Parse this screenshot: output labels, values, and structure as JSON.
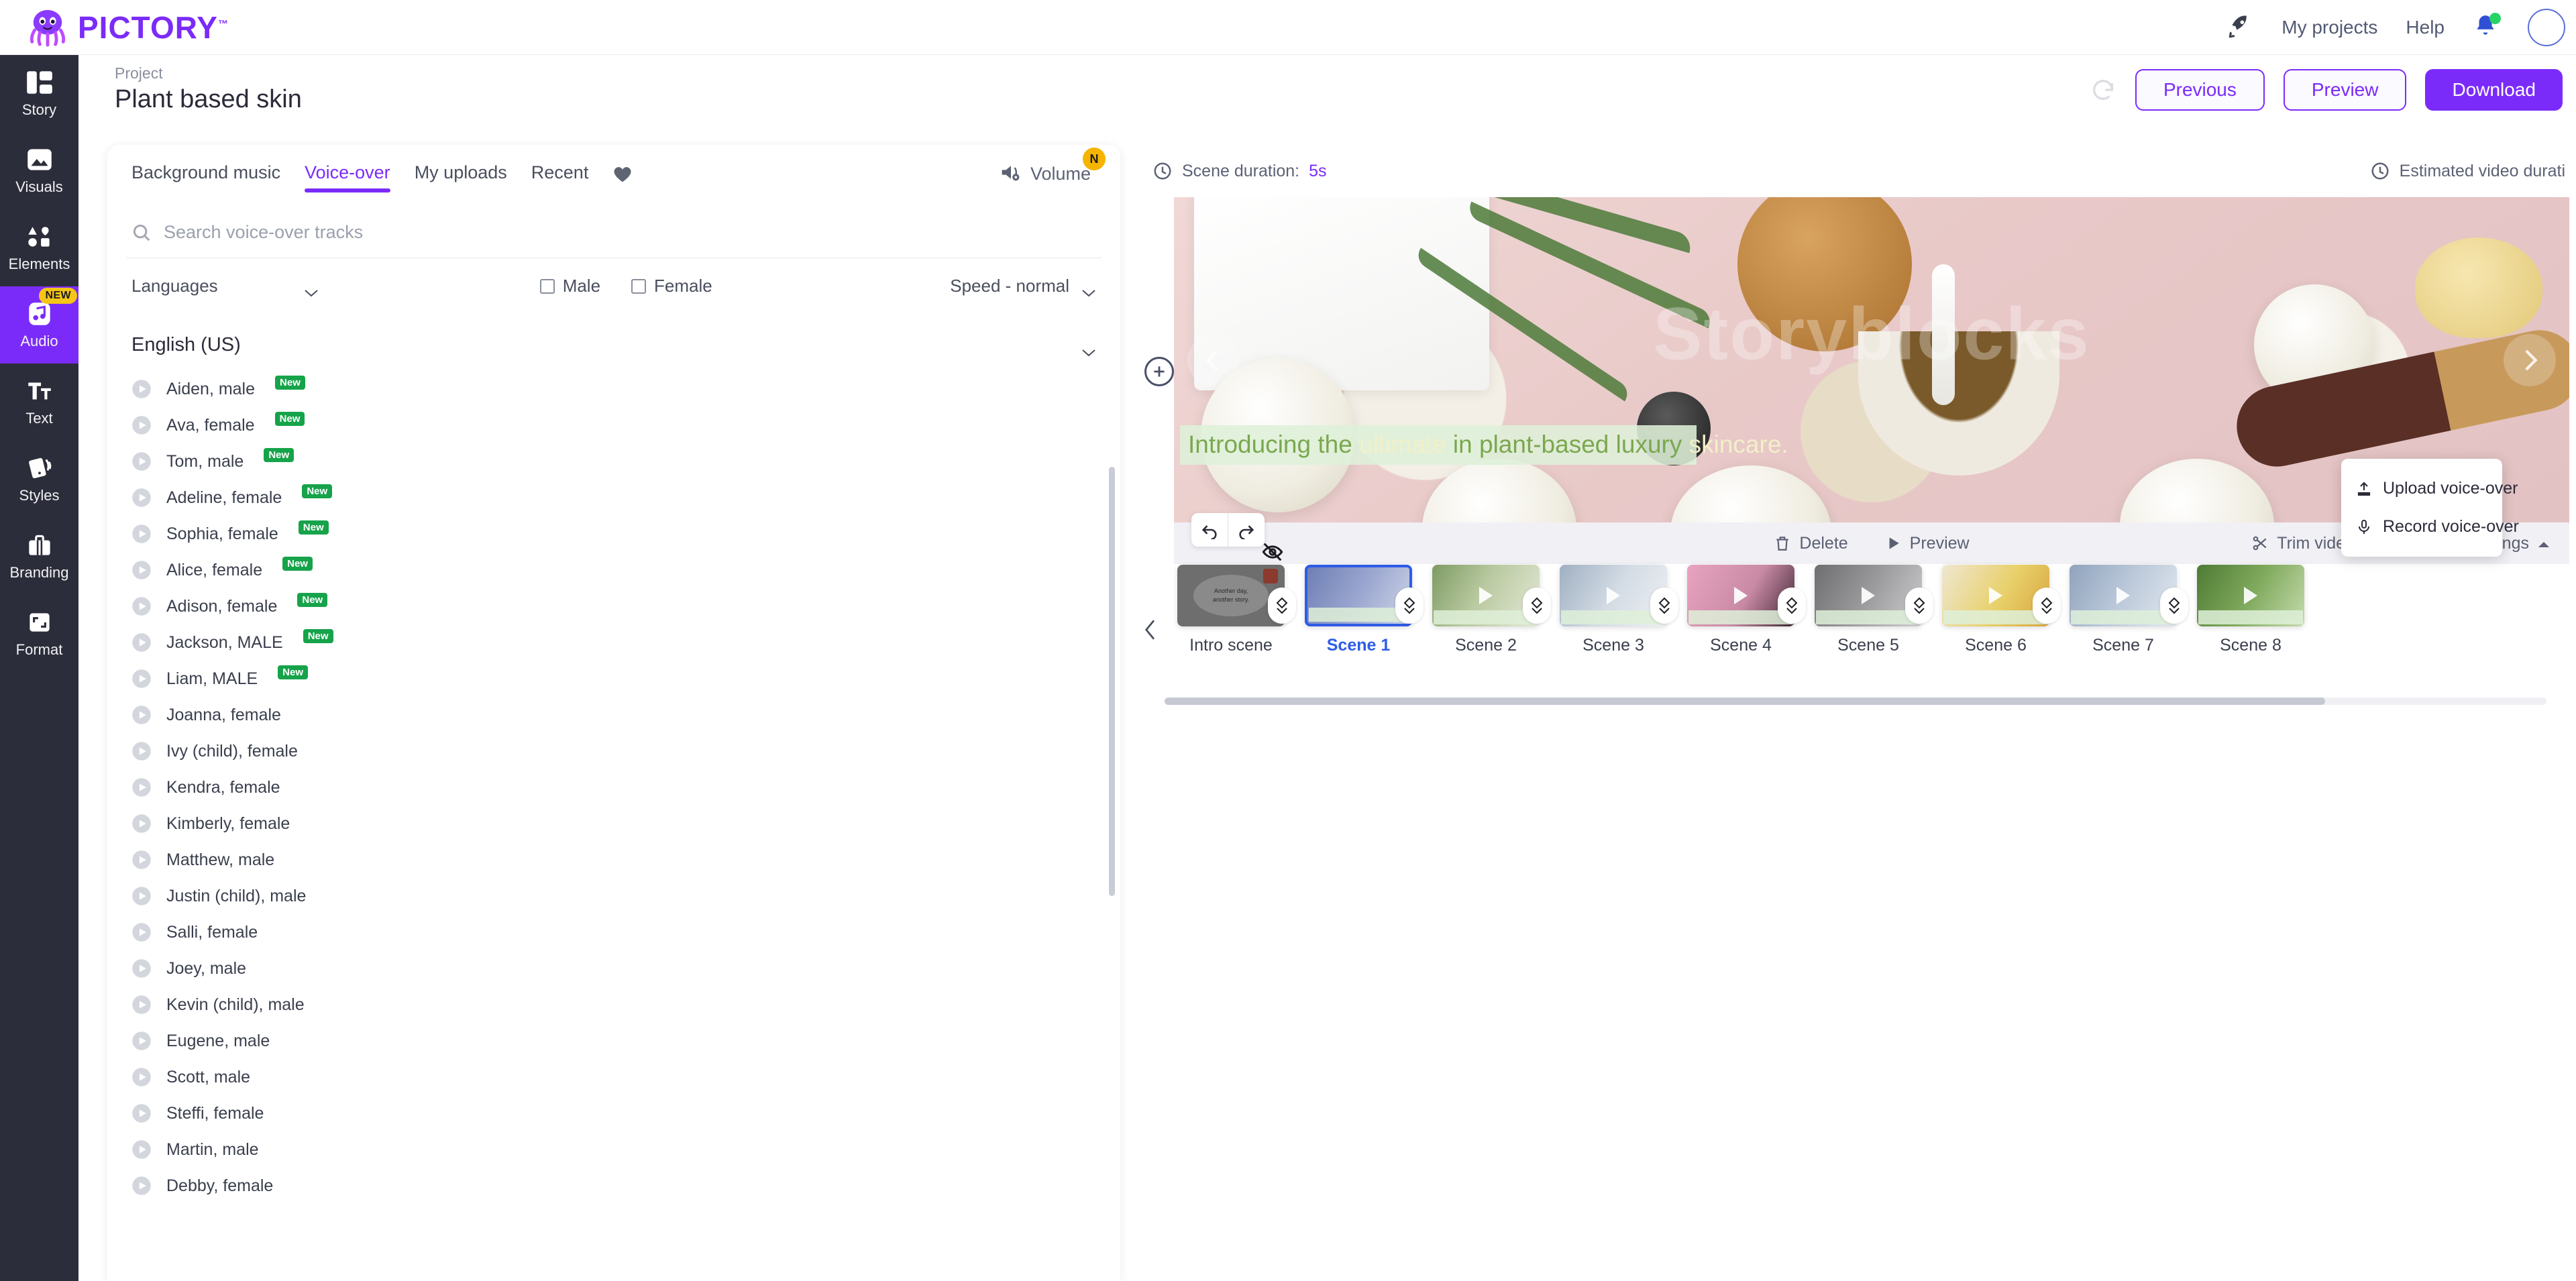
{
  "topbar": {
    "brand": "PICTORY",
    "brand_tm": "™",
    "brand_color": "#7B2BF9",
    "rocket_icon": "rocket-icon",
    "my_projects": "My projects",
    "help": "Help",
    "bell_icon": "notification-bell-icon",
    "avatar": "user-avatar"
  },
  "rail": {
    "items": [
      {
        "label": "Story",
        "icon": "story-icon",
        "active": false,
        "badge": ""
      },
      {
        "label": "Visuals",
        "icon": "image-icon",
        "active": false,
        "badge": ""
      },
      {
        "label": "Elements",
        "icon": "shapes-icon",
        "active": false,
        "badge": ""
      },
      {
        "label": "Audio",
        "icon": "music-note-icon",
        "active": true,
        "badge": "NEW"
      },
      {
        "label": "Text",
        "icon": "text-icon",
        "active": false,
        "badge": ""
      },
      {
        "label": "Styles",
        "icon": "cards-icon",
        "active": false,
        "badge": ""
      },
      {
        "label": "Branding",
        "icon": "briefcase-icon",
        "active": false,
        "badge": ""
      },
      {
        "label": "Format",
        "icon": "crop-icon",
        "active": false,
        "badge": ""
      }
    ]
  },
  "project": {
    "kicker": "Project",
    "title": "Plant based skin",
    "refresh_icon": "refresh-icon",
    "previous": "Previous",
    "preview": "Preview",
    "download": "Download"
  },
  "panel": {
    "tabs": [
      {
        "label": "Background music",
        "active": false
      },
      {
        "label": "Voice-over",
        "active": true
      },
      {
        "label": "My uploads",
        "active": false
      },
      {
        "label": "Recent",
        "active": false
      }
    ],
    "favorites_icon": "heart-icon",
    "volume": {
      "label": "Volume",
      "icon": "volume-gear-icon",
      "badge": "N",
      "badge_color": "#F5B400"
    },
    "search": {
      "placeholder": "Search voice-over tracks",
      "value": "",
      "icon": "search-icon"
    },
    "filters": {
      "languages": "Languages",
      "male": "Male",
      "female": "Female",
      "male_checked": false,
      "female_checked": false,
      "speed": "Speed - normal"
    },
    "language_group": "English (US)",
    "voices": [
      {
        "name": "Aiden, male",
        "badge": "New"
      },
      {
        "name": "Ava, female",
        "badge": "New"
      },
      {
        "name": "Tom, male",
        "badge": "New"
      },
      {
        "name": "Adeline, female",
        "badge": "New"
      },
      {
        "name": "Sophia, female",
        "badge": "New"
      },
      {
        "name": "Alice, female",
        "badge": "New"
      },
      {
        "name": "Adison, female",
        "badge": "New"
      },
      {
        "name": "Jackson, MALE",
        "badge": "New"
      },
      {
        "name": "Liam, MALE",
        "badge": "New"
      },
      {
        "name": "Joanna, female",
        "badge": ""
      },
      {
        "name": "Ivy (child), female",
        "badge": ""
      },
      {
        "name": "Kendra, female",
        "badge": ""
      },
      {
        "name": "Kimberly, female",
        "badge": ""
      },
      {
        "name": "Matthew, male",
        "badge": ""
      },
      {
        "name": "Justin (child), male",
        "badge": ""
      },
      {
        "name": "Salli, female",
        "badge": ""
      },
      {
        "name": "Joey, male",
        "badge": ""
      },
      {
        "name": "Kevin (child), male",
        "badge": ""
      },
      {
        "name": "Eugene, male",
        "badge": ""
      },
      {
        "name": "Scott, male",
        "badge": ""
      },
      {
        "name": "Steffi, female",
        "badge": ""
      },
      {
        "name": "Martin, male",
        "badge": ""
      },
      {
        "name": "Debby, female",
        "badge": ""
      }
    ]
  },
  "stage": {
    "scene_duration_label": "Scene duration:",
    "scene_duration_value": "5s",
    "estimated_label": "Estimated video durati",
    "clock_icon": "clock-icon",
    "watermark": "Storyblocks",
    "prev_arrow_icon": "chevron-left-icon",
    "next_arrow_icon": "chevron-right-icon",
    "add_scene_icon": "plus-circle-icon",
    "caption_words": [
      {
        "text": "Introducing the",
        "style": "green"
      },
      {
        "text": "ultimate",
        "style": "light"
      },
      {
        "text": "in plant-based luxury",
        "style": "green"
      },
      {
        "text": "skincare.",
        "style": "light"
      }
    ],
    "caption_full": "Introducing the ultimate in plant-based luxury skincare.",
    "toolbar": {
      "undo_icon": "undo-icon",
      "redo_icon": "redo-icon",
      "delete": "Delete",
      "delete_icon": "trash-icon",
      "preview": "Preview",
      "preview_icon": "play-icon",
      "trim": "Trim video",
      "trim_icon": "scissors-icon",
      "settings": "Settings",
      "settings_icon": "sliders-icon",
      "settings_chevron": "chevron-up-icon"
    },
    "voiceover_menu": [
      {
        "label": "Upload voice-over",
        "icon": "upload-icon"
      },
      {
        "label": "Record voice-over",
        "icon": "microphone-icon"
      }
    ]
  },
  "timeline": {
    "prev_icon": "chevron-left-icon",
    "transition_icon": "transition-diamond-icon",
    "hidden_icon": "eye-off-icon",
    "intro_text_line1": "Another day,",
    "intro_text_line2": "another story.",
    "scenes": [
      {
        "label": "Intro scene",
        "selected": false,
        "type": "intro"
      },
      {
        "label": "Scene 1",
        "selected": true,
        "type": "video"
      },
      {
        "label": "Scene 2",
        "selected": false,
        "type": "video"
      },
      {
        "label": "Scene 3",
        "selected": false,
        "type": "video"
      },
      {
        "label": "Scene 4",
        "selected": false,
        "type": "video"
      },
      {
        "label": "Scene 5",
        "selected": false,
        "type": "video"
      },
      {
        "label": "Scene 6",
        "selected": false,
        "type": "video"
      },
      {
        "label": "Scene 7",
        "selected": false,
        "type": "video"
      },
      {
        "label": "Scene 8",
        "selected": false,
        "type": "video"
      }
    ]
  }
}
